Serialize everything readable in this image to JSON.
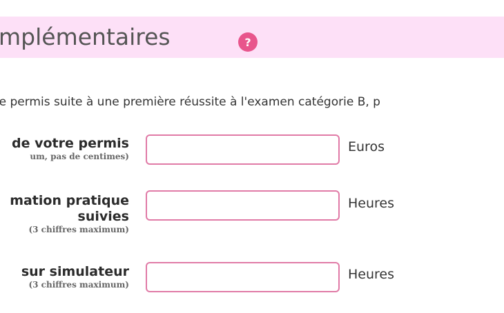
{
  "section": {
    "title": "mplémentaires",
    "help_icon_glyph": "?"
  },
  "intro_text": "re permis suite à une première réussite à l'examen catégorie B, p",
  "fields": [
    {
      "label_lines": [
        "de votre permis"
      ],
      "hint": "um, pas de centimes)",
      "value": "",
      "unit": "Euros"
    },
    {
      "label_lines": [
        "mation pratique",
        "suivies"
      ],
      "hint": "(3 chiffres maximum)",
      "value": "",
      "unit": "Heures"
    },
    {
      "label_lines": [
        "sur simulateur"
      ],
      "hint": "(3 chiffres maximum)",
      "value": "",
      "unit": "Heures"
    }
  ],
  "colors": {
    "header_bg": "#fde0f7",
    "accent": "#e8558c",
    "field_border": "#e07aa6"
  }
}
